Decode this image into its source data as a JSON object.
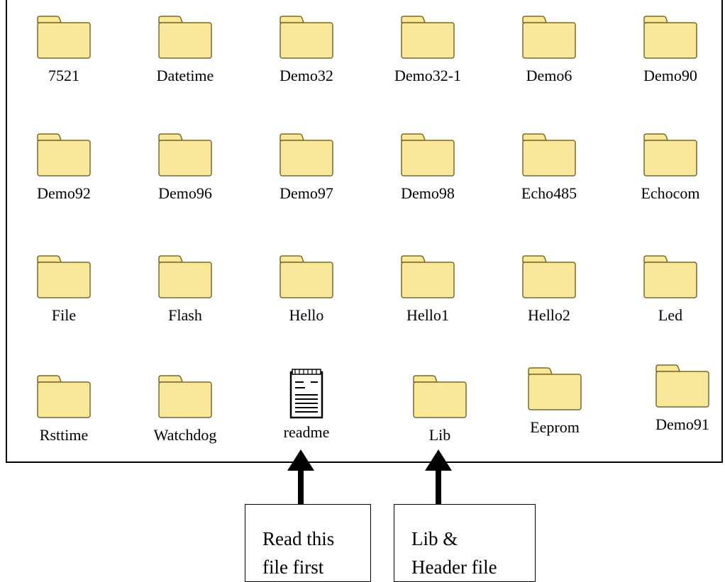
{
  "explorer": {
    "items": [
      {
        "label": "7521",
        "type": "folder"
      },
      {
        "label": "Datetime",
        "type": "folder"
      },
      {
        "label": "Demo32",
        "type": "folder"
      },
      {
        "label": "Demo32-1",
        "type": "folder"
      },
      {
        "label": "Demo6",
        "type": "folder"
      },
      {
        "label": "Demo90",
        "type": "folder"
      },
      {
        "label": "Demo92",
        "type": "folder"
      },
      {
        "label": "Demo96",
        "type": "folder"
      },
      {
        "label": "Demo97",
        "type": "folder"
      },
      {
        "label": "Demo98",
        "type": "folder"
      },
      {
        "label": "Echo485",
        "type": "folder"
      },
      {
        "label": "Echocom",
        "type": "folder"
      },
      {
        "label": "File",
        "type": "folder"
      },
      {
        "label": "Flash",
        "type": "folder"
      },
      {
        "label": "Hello",
        "type": "folder"
      },
      {
        "label": "Hello1",
        "type": "folder"
      },
      {
        "label": "Hello2",
        "type": "folder"
      },
      {
        "label": "Led",
        "type": "folder"
      },
      {
        "label": "Rsttime",
        "type": "folder"
      },
      {
        "label": "Watchdog",
        "type": "folder"
      },
      {
        "label": "readme",
        "type": "document"
      },
      {
        "label": "Lib",
        "type": "folder"
      },
      {
        "label": "Eeprom",
        "type": "folder"
      },
      {
        "label": "Demo91",
        "type": "folder"
      }
    ]
  },
  "callouts": {
    "readme_line1": "Read this",
    "readme_line2": "file first",
    "lib_line1": "Lib &",
    "lib_line2": "Header file"
  },
  "colors": {
    "folder_fill": "#F9E79A",
    "folder_stroke": "#7A6A2A",
    "arrow": "#000000"
  }
}
